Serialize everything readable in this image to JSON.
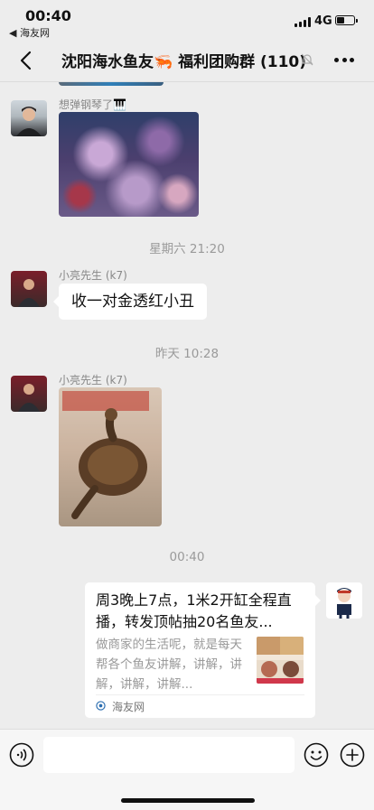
{
  "status_bar": {
    "time": "00:40",
    "back_app": "◀ 海友网",
    "network": "4G"
  },
  "nav": {
    "title": "沈阳海水鱼友🦐 福利团购群 (110)",
    "back_icon": "chevron-left-icon",
    "mute_icon": "bell-off-icon",
    "more_icon": "more-icon"
  },
  "messages": [
    {
      "type": "image",
      "sender": "想弹钢琴了🎹",
      "image": "reef-tank-photo"
    },
    {
      "type": "time",
      "text": "星期六 21:20"
    },
    {
      "type": "text",
      "sender": "小亮先生 (k7)",
      "text": "收一对金透红小丑"
    },
    {
      "type": "time",
      "text": "昨天 10:28"
    },
    {
      "type": "image",
      "sender": "小亮先生 (k7)",
      "image": "turtle-photo"
    },
    {
      "type": "time",
      "text": "00:40"
    },
    {
      "type": "link_card",
      "title": "周3晚上7点，1米2开缸全程直播，转发顶帖抽20名鱼友...",
      "description": "做商家的生活呢，就是每天帮各个鱼友讲解，讲解，讲解，讲解，讲解...",
      "source": "海友网"
    }
  ],
  "input_bar": {
    "placeholder": "",
    "voice_icon": "voice-icon",
    "emoji_icon": "emoji-icon",
    "plus_icon": "plus-icon"
  },
  "colors": {
    "background": "#ededed",
    "bubble": "#ffffff",
    "meta_text": "#9a9a9a"
  }
}
